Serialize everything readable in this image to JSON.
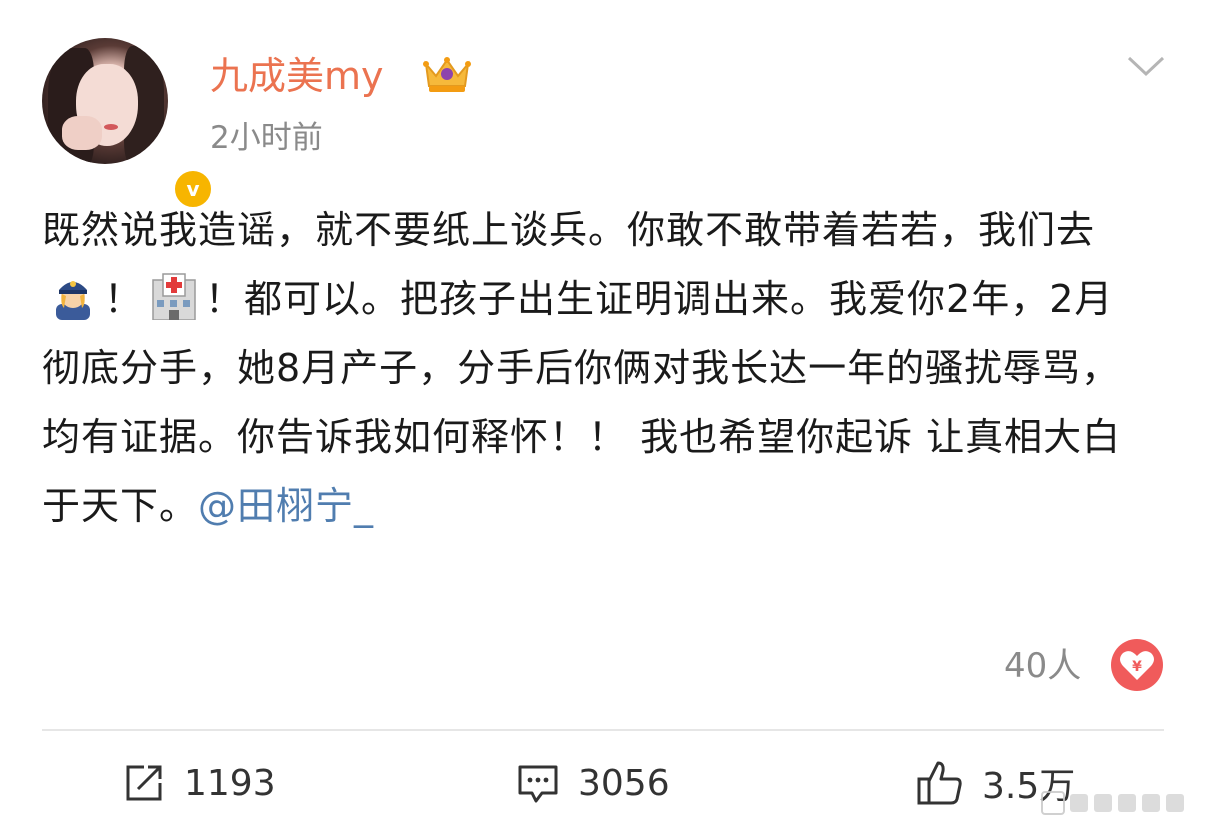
{
  "header": {
    "username": "九成美my",
    "time": "2小时前",
    "verified_mark": "v"
  },
  "post": {
    "text_before_emoji1": "既然说我造谣，就不要纸上谈兵。你敢不敢带着若若，我们去",
    "text_sep1": "！",
    "text_sep2": "！都可以。把孩子出生证明调出来。我爱你2年，2月彻底分手，她8月产子，分手后你俩对我长达一年的骚扰辱骂，均有证据。你告诉我如何释怀！！ 我也希望你起诉 让真相大白于天下。",
    "mention": "@田栩宁_",
    "emoji1": "police-officer-emoji",
    "emoji2": "hospital-emoji"
  },
  "reward": {
    "count": "40人",
    "icon": "reward-heart-icon",
    "symbol": "¥"
  },
  "actions": {
    "repost_count": "1193",
    "comment_count": "3056",
    "like_count": "3.5万"
  },
  "colors": {
    "username": "#eb7350",
    "mention": "#507daf",
    "reward": "#f05b5b",
    "verified": "#f7b500"
  }
}
